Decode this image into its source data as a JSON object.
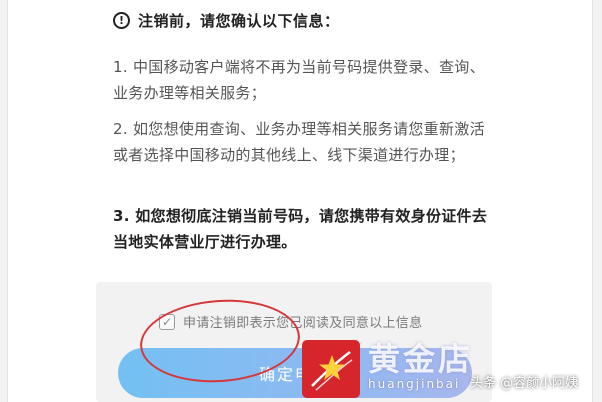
{
  "notice": {
    "icon": "exclamation-circle-icon",
    "heading": "注销前，请您确认以下信息：",
    "items": [
      "1. 中国移动客户端将不再为当前号码提供登录、查询、业务办理等相关服务；",
      "2. 如您想使用查询、业务办理等相关服务请您重新激活或者选择中国移动的其他线上、线下渠道进行办理；",
      "3. 如您想彻底注销当前号码，请您携带有效身份证件去当地实体营业厅进行办理。"
    ]
  },
  "agreement": {
    "checked": true,
    "label": "申请注销即表示您已阅读及同意以上信息"
  },
  "confirm_button": {
    "label": "确定申请"
  },
  "overlay": {
    "annotation_color": "#d6383a",
    "logo_color": "#d6252b",
    "watermark_main": "黄金店",
    "watermark_sub": "huangjinbai",
    "credit": "头条 @容颜小阿姨"
  }
}
